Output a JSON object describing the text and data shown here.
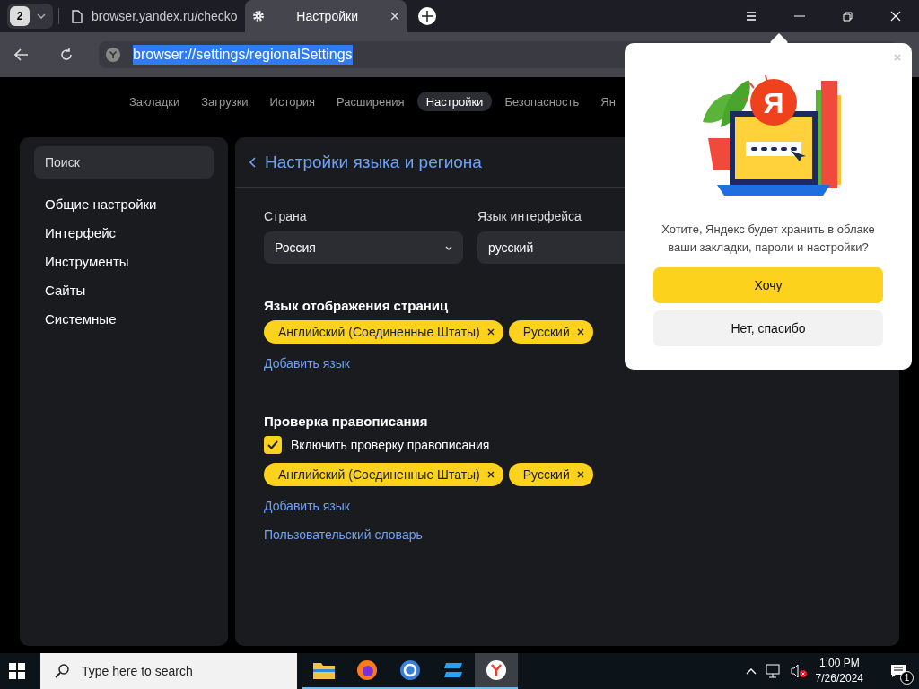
{
  "browser": {
    "tab_count": "2",
    "tabs": [
      {
        "title": "browser.yandex.ru/checko",
        "kind": "page",
        "selected": false
      },
      {
        "title": "Настройки",
        "kind": "settings",
        "selected": true
      }
    ],
    "address": "browser://settings/regionalSettings"
  },
  "nav": [
    {
      "label": "Закладки",
      "selected": false
    },
    {
      "label": "Загрузки",
      "selected": false
    },
    {
      "label": "История",
      "selected": false
    },
    {
      "label": "Расширения",
      "selected": false
    },
    {
      "label": "Настройки",
      "selected": true
    },
    {
      "label": "Безопасность",
      "selected": false
    },
    {
      "label": "Ян",
      "selected": false
    }
  ],
  "sidebar": {
    "search": {
      "placeholder": "Поиск"
    },
    "items": [
      {
        "label": "Общие настройки",
        "selected": false
      },
      {
        "label": "Интерфейс",
        "selected": false
      },
      {
        "label": "Инструменты",
        "selected": false
      },
      {
        "label": "Сайты",
        "selected": false
      },
      {
        "label": "Системные",
        "selected": false
      }
    ]
  },
  "page": {
    "title": "Настройки языка и региона",
    "country": {
      "label": "Страна",
      "value": "Россия"
    },
    "ui_language": {
      "label": "Язык интерфейса",
      "value": "русский"
    },
    "display_languages": {
      "heading": "Язык отображения страниц",
      "chips": [
        "Английский (Соединенные Штаты)",
        "Русский"
      ],
      "add_link": "Добавить язык"
    },
    "spellcheck": {
      "heading": "Проверка правописания",
      "checkbox": {
        "label": "Включить проверку правописания",
        "checked": true
      },
      "chips": [
        "Английский (Соединенные Штаты)",
        "Русский"
      ],
      "add_link": "Добавить язык",
      "dictionary_link": "Пользовательский словарь"
    }
  },
  "popup": {
    "logo_letter": "Я",
    "message": "Хотите, Яндекс будет хранить в облаке ваши закладки, пароли и настройки?",
    "accept": "Хочу",
    "decline": "Нет, спасибо"
  },
  "taskbar": {
    "search_placeholder": "Type here to search",
    "apps": [
      {
        "kind": "explorer",
        "selected": false
      },
      {
        "kind": "firefox",
        "selected": false
      },
      {
        "kind": "chrome",
        "selected": false
      },
      {
        "kind": "blue",
        "selected": false
      },
      {
        "kind": "yandex",
        "selected": true
      }
    ],
    "time": "1:00 PM",
    "date": "7/26/2024",
    "notifications": "1"
  }
}
